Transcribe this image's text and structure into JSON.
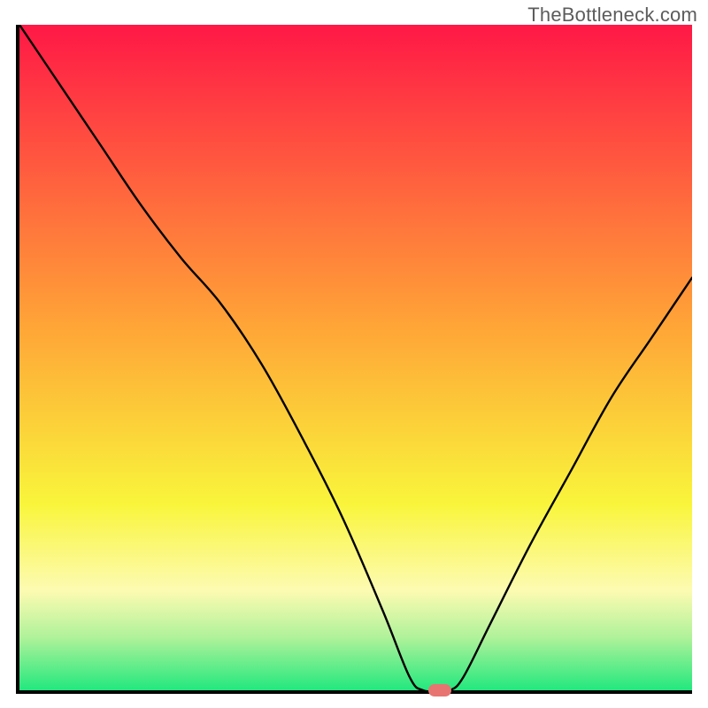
{
  "watermark": "TheBottleneck.com",
  "colors": {
    "red": "#ff1846",
    "orange": "#ffa437",
    "yellow": "#f9f53b",
    "yellow_pale": "#fdfbb2",
    "green_light": "#b0f29a",
    "green": "#22e87e",
    "curve": "#000000",
    "axis": "#000000",
    "marker": "#e87472"
  },
  "chart_data": {
    "type": "line",
    "title": "",
    "xlabel": "",
    "ylabel": "",
    "xlim": [
      0,
      100
    ],
    "ylim": [
      0,
      100
    ],
    "x": [
      0,
      6,
      12,
      18,
      24,
      30,
      36,
      42,
      48,
      54,
      58,
      60,
      62,
      64,
      66,
      70,
      76,
      82,
      88,
      94,
      100
    ],
    "values": [
      100,
      91,
      82,
      73,
      65,
      58,
      49,
      38,
      26,
      12,
      2,
      0,
      0,
      0,
      2,
      10,
      22,
      33,
      44,
      53,
      62
    ],
    "marker": {
      "x": 62.5,
      "y": 0
    },
    "gradient_stops": [
      {
        "pct": 0,
        "color": "#ff1846"
      },
      {
        "pct": 45,
        "color": "#ffa437"
      },
      {
        "pct": 72,
        "color": "#f9f53b"
      },
      {
        "pct": 85,
        "color": "#fdfbb2"
      },
      {
        "pct": 92,
        "color": "#b0f29a"
      },
      {
        "pct": 100,
        "color": "#22e87e"
      }
    ]
  }
}
